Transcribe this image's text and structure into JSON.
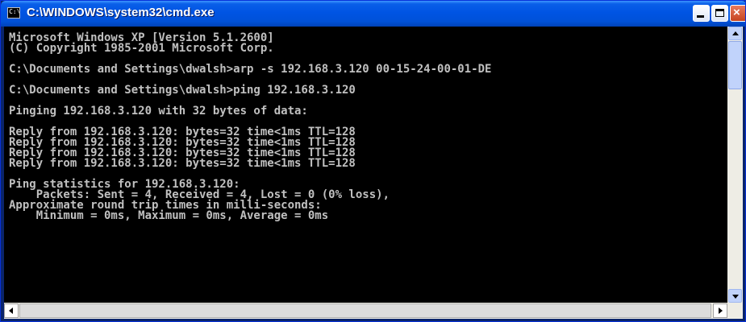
{
  "window": {
    "title": "C:\\WINDOWS\\system32\\cmd.exe",
    "icon": "cmd-prompt-icon",
    "icon_glyph": "C:\\",
    "controls": {
      "minimize": "minimize-icon",
      "maximize": "maximize-icon",
      "close_glyph": "×"
    }
  },
  "console": {
    "lines": [
      "Microsoft Windows XP [Version 5.1.2600]",
      "(C) Copyright 1985-2001 Microsoft Corp.",
      "",
      "C:\\Documents and Settings\\dwalsh>arp -s 192.168.3.120 00-15-24-00-01-DE",
      "",
      "C:\\Documents and Settings\\dwalsh>ping 192.168.3.120",
      "",
      "Pinging 192.168.3.120 with 32 bytes of data:",
      "",
      "Reply from 192.168.3.120: bytes=32 time<1ms TTL=128",
      "Reply from 192.168.3.120: bytes=32 time<1ms TTL=128",
      "Reply from 192.168.3.120: bytes=32 time<1ms TTL=128",
      "Reply from 192.168.3.120: bytes=32 time<1ms TTL=128",
      "",
      "Ping statistics for 192.168.3.120:",
      "    Packets: Sent = 4, Received = 4, Lost = 0 (0% loss),",
      "Approximate round trip times in milli-seconds:",
      "    Minimum = 0ms, Maximum = 0ms, Average = 0ms"
    ]
  },
  "colors": {
    "console_background": "#000000",
    "console_text": "#c0c0c0",
    "titlebar": "#0054e3"
  }
}
